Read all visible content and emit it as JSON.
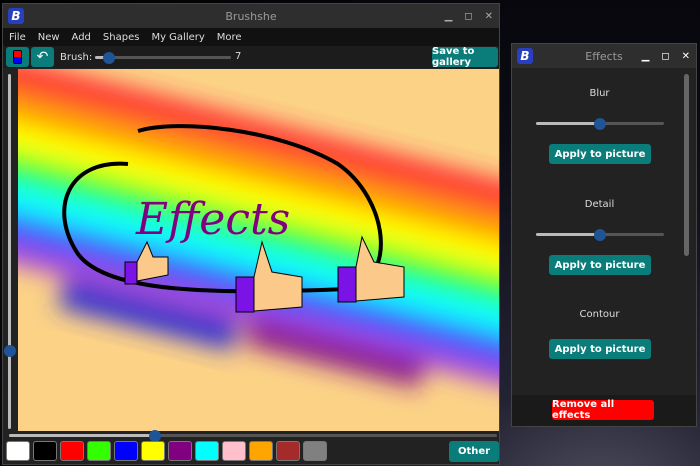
{
  "main_window": {
    "title": "Brushshe",
    "logo": "B",
    "controls": [
      "minimize",
      "maximize",
      "close"
    ]
  },
  "menu": [
    "File",
    "New",
    "Add",
    "Shapes",
    "My Gallery",
    "More"
  ],
  "toolbar": {
    "brush_label": "Brush:",
    "brush_size": "7",
    "brush_fraction": 0.1,
    "save_label": "Save to gallery",
    "fg_color": "#ff0000",
    "bg_color": "#0000ff"
  },
  "canvas": {
    "text": "Effects",
    "zoom_v_fraction": 0.78,
    "zoom_h_fraction": 0.3
  },
  "palette": {
    "colors": [
      "#ffffff",
      "#000000",
      "#ff0000",
      "#33ff00",
      "#0000ff",
      "#ffff00",
      "#800080",
      "#00ffff",
      "#ffc0cb",
      "#ffa500",
      "#a52a2a",
      "#808080"
    ],
    "other_label": "Other"
  },
  "effects_window": {
    "title": "Effects",
    "sections": [
      {
        "label": "Blur",
        "slider": 0.5,
        "button": "Apply to picture"
      },
      {
        "label": "Detail",
        "slider": 0.5,
        "button": "Apply to picture"
      },
      {
        "label": "Contour",
        "button": "Apply to picture"
      }
    ],
    "remove_label": "Remove all effects"
  }
}
